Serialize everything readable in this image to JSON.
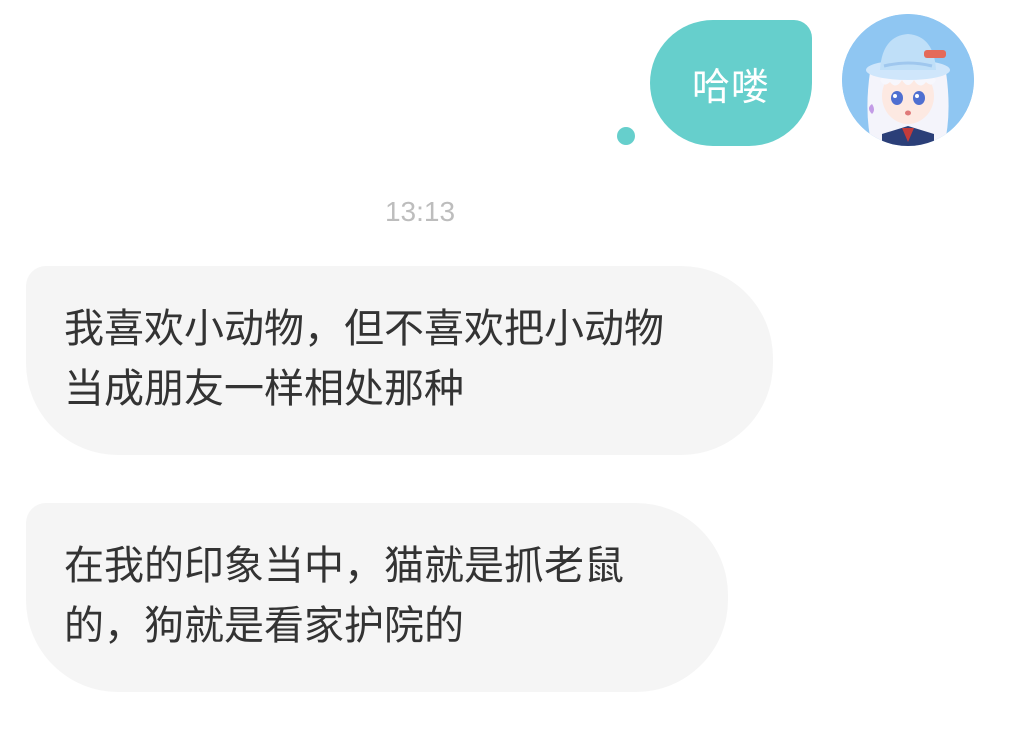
{
  "timestamp": "13:13",
  "outgoing": {
    "text": "哈喽",
    "status": "unread-dot",
    "accent_color": "#66cfcc"
  },
  "incoming": [
    {
      "lines": [
        "我喜欢小动物，但不喜欢把小动物",
        "当成朋友一样相处那种"
      ]
    },
    {
      "lines": [
        "在我的印象当中，猫就是抓老鼠",
        "的，狗就是看家护院的"
      ]
    }
  ],
  "colors": {
    "bubble_in": "#f5f5f5",
    "text_in": "#333333",
    "timestamp": "#bdbdbd"
  }
}
